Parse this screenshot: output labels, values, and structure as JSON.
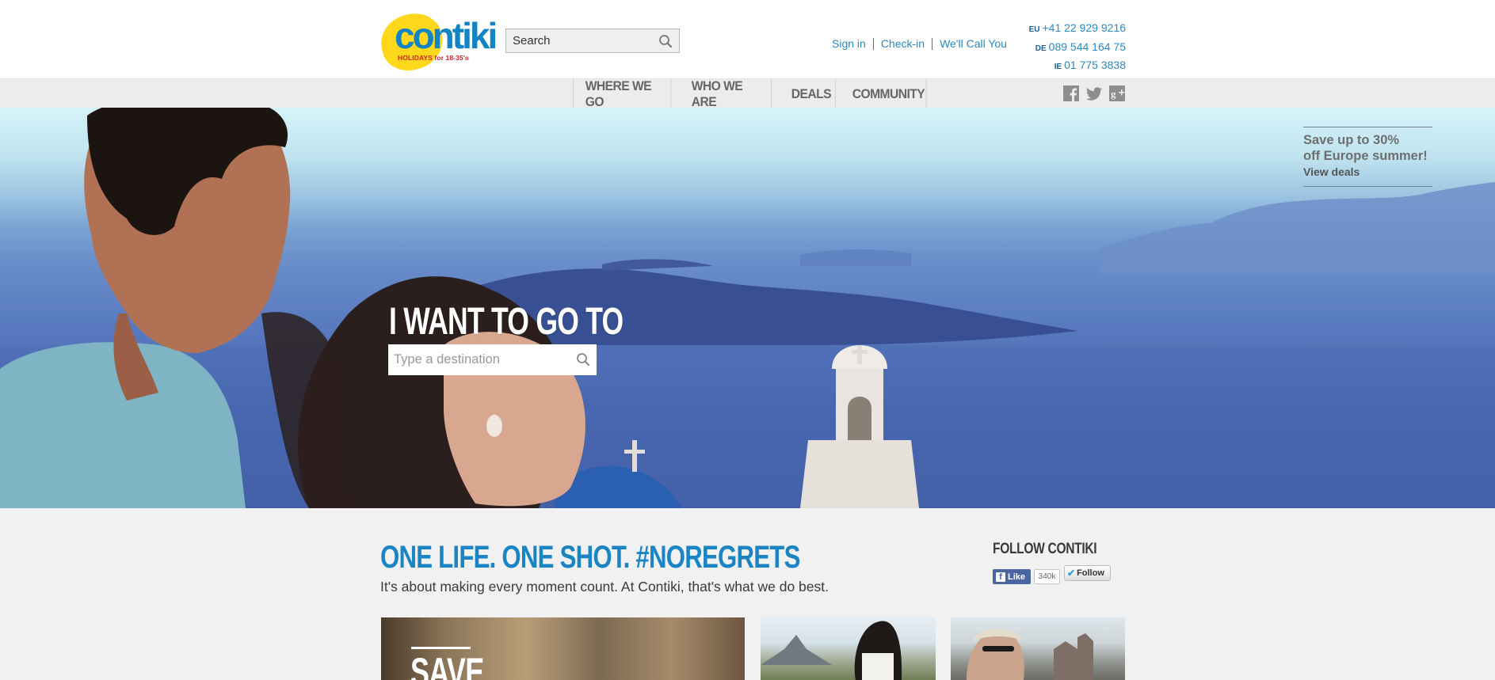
{
  "header": {
    "logo": {
      "word": "contiki",
      "tagline": "HOLIDAYS for 18-35's"
    },
    "search": {
      "placeholder": "Search",
      "icon": "search-icon"
    },
    "links": [
      "Sign in",
      "Check-in",
      "We'll Call You"
    ],
    "phones": [
      {
        "code": "EU",
        "number": "+41 22 929 9216"
      },
      {
        "code": "DE",
        "number": "089 544 164 75"
      },
      {
        "code": "IE",
        "number": "01 775 3838"
      }
    ]
  },
  "nav": {
    "items": [
      "WHERE WE GO",
      "WHO WE ARE",
      "DEALS",
      "COMMUNITY"
    ],
    "social_icons": [
      "facebook-icon",
      "twitter-icon",
      "google-plus-icon"
    ]
  },
  "hero": {
    "promo": {
      "title": "Save up to 30%\noff Europe summer!",
      "link": "View deals"
    },
    "heading": "I WANT TO GO TO",
    "destination_placeholder": "Type a destination"
  },
  "main": {
    "headline": "ONE LIFE. ONE SHOT. #NOREGRETS",
    "subtitle": "It's about making every moment count. At Contiki, that's what we do best.",
    "follow": {
      "title": "FOLLOW CONTIKI",
      "like_label": "Like",
      "like_count": "340k",
      "follow_label": "Follow"
    },
    "tiles": [
      {
        "label": "SAVE"
      },
      {
        "label": ""
      },
      {
        "label": ""
      }
    ]
  },
  "colors": {
    "brand_blue": "#1a84c4",
    "link_blue": "#2a8ac8",
    "logo_yellow": "#ffd81c",
    "logo_red": "#d2202f"
  }
}
